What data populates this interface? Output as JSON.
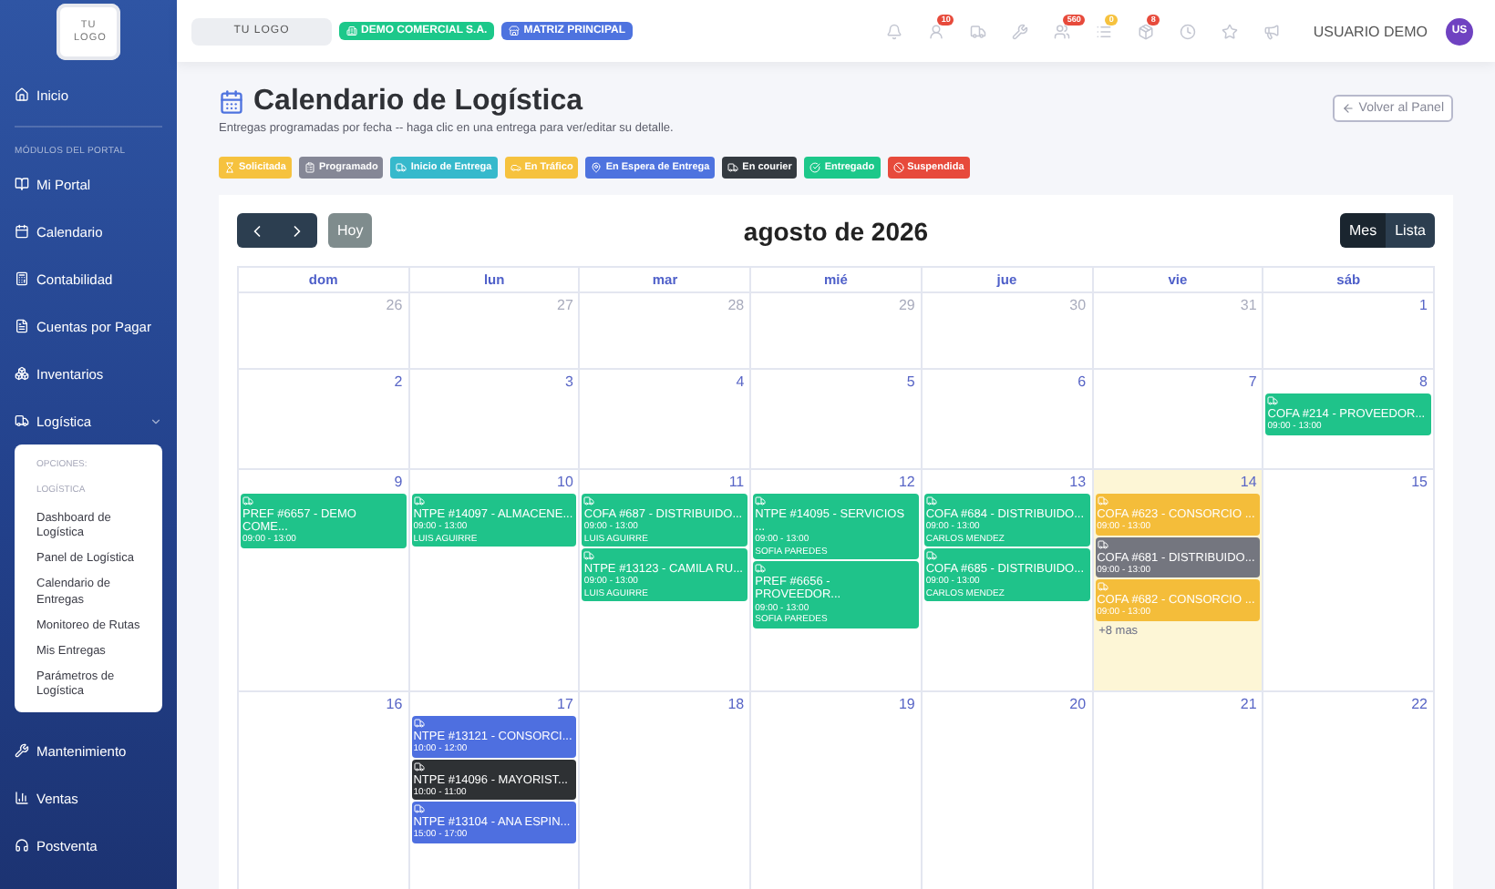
{
  "sidebar": {
    "logo": "TU LOGO",
    "home": "Inicio",
    "section_label": "MÓDULOS DEL PORTAL",
    "modules": [
      {
        "label": "Mi Portal"
      },
      {
        "label": "Calendario"
      },
      {
        "label": "Contabilidad"
      },
      {
        "label": "Cuentas por Pagar"
      },
      {
        "label": "Inventarios"
      },
      {
        "label": "Logística",
        "expanded": true,
        "submenu": {
          "heading": "OPCIONES:",
          "section": "LOGÍSTICA",
          "items": [
            "Dashboard de Logística",
            "Panel de Logística",
            "Calendario de Entregas",
            "Monitoreo de Rutas",
            "Mis Entregas",
            "Parámetros de Logística"
          ]
        }
      },
      {
        "label": "Mantenimiento"
      },
      {
        "label": "Ventas"
      },
      {
        "label": "Postventa"
      }
    ]
  },
  "topbar": {
    "logo": "TU LOGO",
    "company": "DEMO COMERCIAL S.A.",
    "branch": "MATRIZ PRINCIPAL",
    "icons": [
      {
        "kind": "bell"
      },
      {
        "kind": "user",
        "badge": "10",
        "color": "#e74a3b"
      },
      {
        "kind": "truck"
      },
      {
        "kind": "tools"
      },
      {
        "kind": "users",
        "badge": "560",
        "color": "#e74a3b"
      },
      {
        "kind": "list",
        "badge": "0",
        "color": "#f6c23e"
      },
      {
        "kind": "box",
        "badge": "8",
        "color": "#e74a3b"
      },
      {
        "kind": "clock"
      },
      {
        "kind": "star"
      },
      {
        "kind": "megaphone"
      }
    ],
    "user": "USUARIO DEMO",
    "avatar": "US"
  },
  "page": {
    "title": "Calendario de Logística",
    "subtitle": "Entregas programadas por fecha -- haga clic en una entrega para ver/editar su detalle.",
    "back_button": "Volver al Panel"
  },
  "legend": [
    {
      "label": "Solicitada",
      "color": "#f6c23e"
    },
    {
      "label": "Programado",
      "color": "#858796"
    },
    {
      "label": "Inicio de Entrega",
      "color": "#36b9cc"
    },
    {
      "label": "En Tráfico",
      "color": "#f6c23e"
    },
    {
      "label": "En Espera de Entrega",
      "color": "#4e73df"
    },
    {
      "label": "En courier",
      "color": "#343a40"
    },
    {
      "label": "Entregado",
      "color": "#1cc88a"
    },
    {
      "label": "Suspendida",
      "color": "#e74a3b"
    }
  ],
  "calendar": {
    "today_button": "Hoy",
    "title": "agosto de 2026",
    "views": [
      {
        "label": "Mes",
        "selected": true
      },
      {
        "label": "Lista",
        "selected": false
      }
    ],
    "weekdays": [
      "dom",
      "lun",
      "mar",
      "mié",
      "jue",
      "vie",
      "sáb"
    ],
    "weeks": [
      {
        "days": [
          {
            "day": "26",
            "other_month": true,
            "today": false
          },
          {
            "day": "27",
            "other_month": true,
            "today": false
          },
          {
            "day": "28",
            "other_month": true,
            "today": false
          },
          {
            "day": "29",
            "other_month": true,
            "today": false
          },
          {
            "day": "30",
            "other_month": true,
            "today": false
          },
          {
            "day": "31",
            "other_month": true,
            "today": false
          },
          {
            "day": "1",
            "other_month": false,
            "today": false
          }
        ]
      },
      {
        "days": [
          {
            "day": "2",
            "other_month": false,
            "today": false
          },
          {
            "day": "3",
            "other_month": false,
            "today": false
          },
          {
            "day": "4",
            "other_month": false,
            "today": false
          },
          {
            "day": "5",
            "other_month": false,
            "today": false
          },
          {
            "day": "6",
            "other_month": false,
            "today": false
          },
          {
            "day": "7",
            "other_month": false,
            "today": false
          },
          {
            "day": "8",
            "other_month": false,
            "today": false,
            "events": [
              {
                "title": "COFA #214 - PROVEEDOR...",
                "time": "09:00 - 13:00",
                "color": "#1fc38a"
              }
            ]
          }
        ]
      },
      {
        "days": [
          {
            "day": "9",
            "other_month": false,
            "today": false,
            "events": [
              {
                "title": "PREF #6657 - DEMO COME...",
                "time": "09:00 - 13:00",
                "color": "#1fc38a"
              }
            ]
          },
          {
            "day": "10",
            "other_month": false,
            "today": false,
            "events": [
              {
                "title": "NTPE #14097 - ALMACENE...",
                "time": "09:00 - 13:00",
                "driver": "LUIS AGUIRRE",
                "color": "#1fc38a"
              }
            ]
          },
          {
            "day": "11",
            "other_month": false,
            "today": false,
            "events": [
              {
                "title": "COFA #687 - DISTRIBUIDO...",
                "time": "09:00 - 13:00",
                "driver": "LUIS AGUIRRE",
                "color": "#1fc38a"
              },
              {
                "title": "NTPE #13123 - CAMILA RU...",
                "time": "09:00 - 13:00",
                "driver": "LUIS AGUIRRE",
                "color": "#1fc38a"
              }
            ]
          },
          {
            "day": "12",
            "other_month": false,
            "today": false,
            "events": [
              {
                "title": "NTPE #14095 - SERVICIOS ...",
                "time": "09:00 - 13:00",
                "driver": "SOFIA PAREDES",
                "color": "#1fc38a"
              },
              {
                "title": "PREF #6656 - PROVEEDOR...",
                "time": "09:00 - 13:00",
                "driver": "SOFIA PAREDES",
                "color": "#1fc38a"
              }
            ]
          },
          {
            "day": "13",
            "other_month": false,
            "today": false,
            "events": [
              {
                "title": "COFA #684 - DISTRIBUIDO...",
                "time": "09:00 - 13:00",
                "driver": "CARLOS MENDEZ",
                "color": "#1fc38a"
              },
              {
                "title": "COFA #685 - DISTRIBUIDO...",
                "time": "09:00 - 13:00",
                "driver": "CARLOS MENDEZ",
                "color": "#1fc38a"
              }
            ]
          },
          {
            "day": "14",
            "other_month": false,
            "today": true,
            "more": "+8 mas",
            "events": [
              {
                "title": "COFA #623 - CONSORCIO ...",
                "time": "09:00 - 13:00",
                "color": "#f4bd3a"
              },
              {
                "title": "COFA #681 - DISTRIBUIDO...",
                "time": "09:00 - 13:00",
                "color": "#74767f"
              },
              {
                "title": "COFA #682 - CONSORCIO ...",
                "time": "09:00 - 13:00",
                "color": "#f4bd3a"
              }
            ]
          },
          {
            "day": "15",
            "other_month": false,
            "today": false
          }
        ]
      },
      {
        "days": [
          {
            "day": "16",
            "other_month": false,
            "today": false
          },
          {
            "day": "17",
            "other_month": false,
            "today": false,
            "events": [
              {
                "title": "NTPE #13121 - CONSORCI...",
                "time": "10:00 - 12:00",
                "color": "#4e6fe0"
              },
              {
                "title": "NTPE #14096 - MAYORIST...",
                "time": "10:00 - 11:00",
                "color": "#2e3134"
              },
              {
                "title": "NTPE #13104 - ANA ESPIN...",
                "time": "15:00 - 17:00",
                "color": "#4e6fe0"
              }
            ]
          },
          {
            "day": "18",
            "other_month": false,
            "today": false
          },
          {
            "day": "19",
            "other_month": false,
            "today": false
          },
          {
            "day": "20",
            "other_month": false,
            "today": false
          },
          {
            "day": "21",
            "other_month": false,
            "today": false
          },
          {
            "day": "22",
            "other_month": false,
            "today": false
          }
        ]
      }
    ]
  }
}
